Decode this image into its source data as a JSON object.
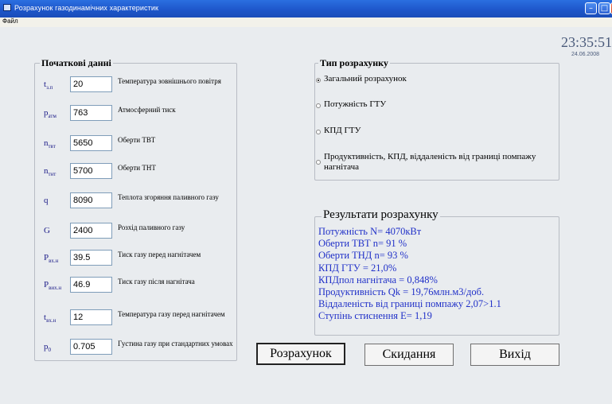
{
  "window": {
    "title": "Розрахунок газодинамічних характеристик"
  },
  "menu": {
    "file": "Файл"
  },
  "clock": {
    "time": "23:35:51",
    "date": "24.06.2008"
  },
  "initial": {
    "legend": "Початкові данні",
    "params": [
      {
        "sym": "t",
        "sub": "з.п",
        "value": "20",
        "desc": "Температура зовнішнього повітря"
      },
      {
        "sym": "p",
        "sub": "атм",
        "value": "763",
        "desc": "Атмосферний тиск"
      },
      {
        "sym": "n",
        "sub": "твт",
        "value": "5650",
        "desc": "Оберти ТВТ"
      },
      {
        "sym": "n",
        "sub": "тнт",
        "value": "5700",
        "desc": "Оберти ТНТ"
      },
      {
        "sym": "q",
        "sub": "",
        "value": "8090",
        "desc": "Теплота згоряння паливного газу"
      },
      {
        "sym": "G",
        "sub": "",
        "value": "2400",
        "desc": "Розхід паливного газу"
      },
      {
        "sym": "P",
        "sub": "вх.н",
        "value": "39.5",
        "desc": "Тиск газу перед нагнітачем"
      },
      {
        "sym": "P",
        "sub": "вих.н",
        "value": "46.9",
        "desc": "Тиск газу після нагнітача"
      },
      {
        "sym": "t",
        "sub": "вх.н",
        "value": "12",
        "desc": "Температура газу перед нагнітачем"
      },
      {
        "sym": "p",
        "sub": "0",
        "value": "0.705",
        "desc": "Густина газу при стандартних умовах"
      }
    ]
  },
  "calc_type": {
    "legend": "Тип розрахунку",
    "options": [
      {
        "label": "Загальний розрахунок",
        "checked": true
      },
      {
        "label": "Потужність ГТУ",
        "checked": false
      },
      {
        "label": "КПД ГТУ",
        "checked": false
      },
      {
        "label": "Продуктивність, КПД, віддаленість від границі помпажу нагнітача",
        "checked": false
      }
    ]
  },
  "results": {
    "legend": "Результати розрахунку",
    "lines": [
      "Потужність N= 4070кВт",
      "Оберти ТВТ n= 91 %",
      "Оберти ТНД n= 93 %",
      "КПД ГТУ = 21,0%",
      "КПДпол нагнітача = 0,848%",
      "Продуктивність Qk = 19,76млн.м3/доб.",
      "Віддаленість від границі помпажу 2,07>1.1",
      "Ступінь стиснення Е= 1,19"
    ]
  },
  "buttons": {
    "calculate": "Розрахунок",
    "reset": "Скидання",
    "exit": "Вихід"
  }
}
